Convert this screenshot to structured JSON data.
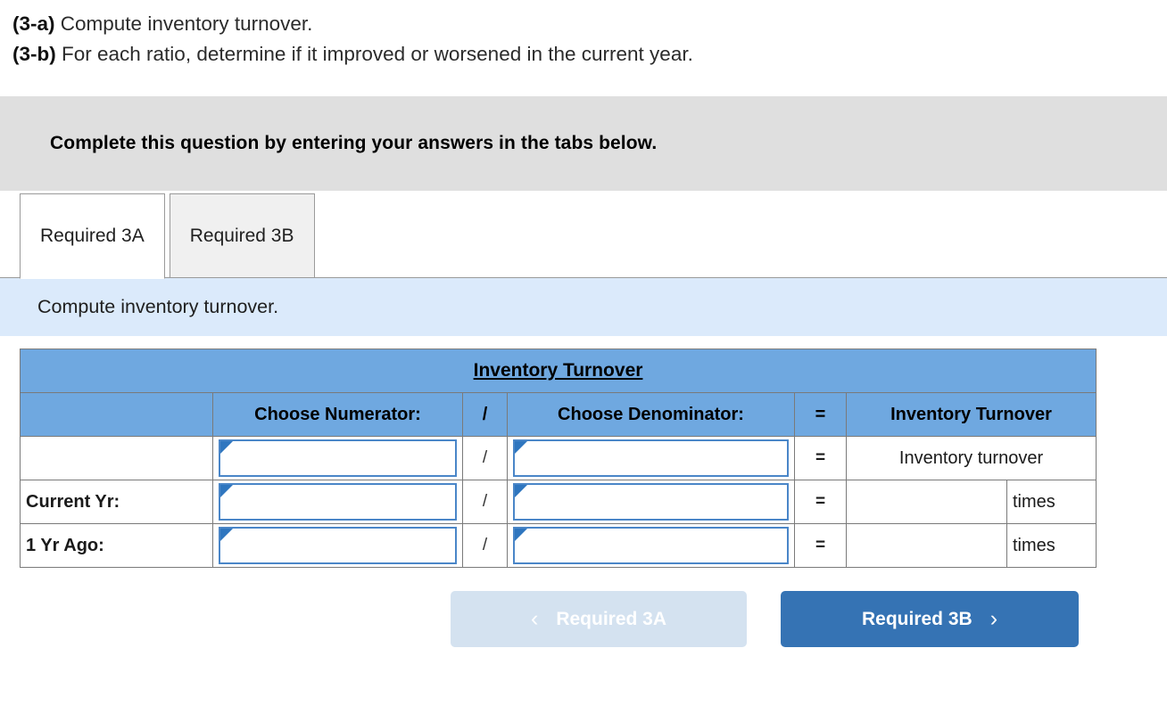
{
  "prompt": {
    "lines": [
      {
        "tag": "(3-a)",
        "text": " Compute inventory turnover."
      },
      {
        "tag": "(3-b)",
        "text": " For each ratio, determine if it improved or worsened in the current year."
      }
    ]
  },
  "instruction": {
    "text": "Complete this question by entering your answers in the tabs below."
  },
  "tabs": [
    {
      "label": "Required 3A",
      "active": true
    },
    {
      "label": "Required 3B",
      "active": false
    }
  ],
  "subinstruction": {
    "text": "Compute inventory turnover."
  },
  "table": {
    "title": "Inventory Turnover",
    "headers": {
      "blank": "",
      "numerator": "Choose Numerator:",
      "slash": "/",
      "denominator": "Choose Denominator:",
      "equals": "=",
      "result": "Inventory Turnover"
    },
    "rows": [
      {
        "label": "",
        "numerator_value": "",
        "slash": "/",
        "denominator_value": "",
        "equals": "=",
        "result": "Inventory turnover",
        "unit": ""
      },
      {
        "label": "Current Yr:",
        "numerator_value": "",
        "slash": "/",
        "denominator_value": "",
        "equals": "=",
        "result": "",
        "unit": "times"
      },
      {
        "label": "1 Yr Ago:",
        "numerator_value": "",
        "slash": "/",
        "denominator_value": "",
        "equals": "=",
        "result": "",
        "unit": "times"
      }
    ]
  },
  "nav": {
    "prev_label": "Required 3A",
    "prev_icon": "chevron-left-icon",
    "prev_glyph": "‹",
    "next_label": "Required 3B",
    "next_icon": "chevron-right-icon",
    "next_glyph": "›"
  },
  "colors": {
    "header_blue": "#6fa8e0",
    "band_light_blue": "#dbeafb",
    "instruction_gray": "#dfdfdf",
    "button_blue": "#3573b4",
    "button_disabled": "#d4e2f0",
    "input_border_blue": "#4a86c8"
  }
}
